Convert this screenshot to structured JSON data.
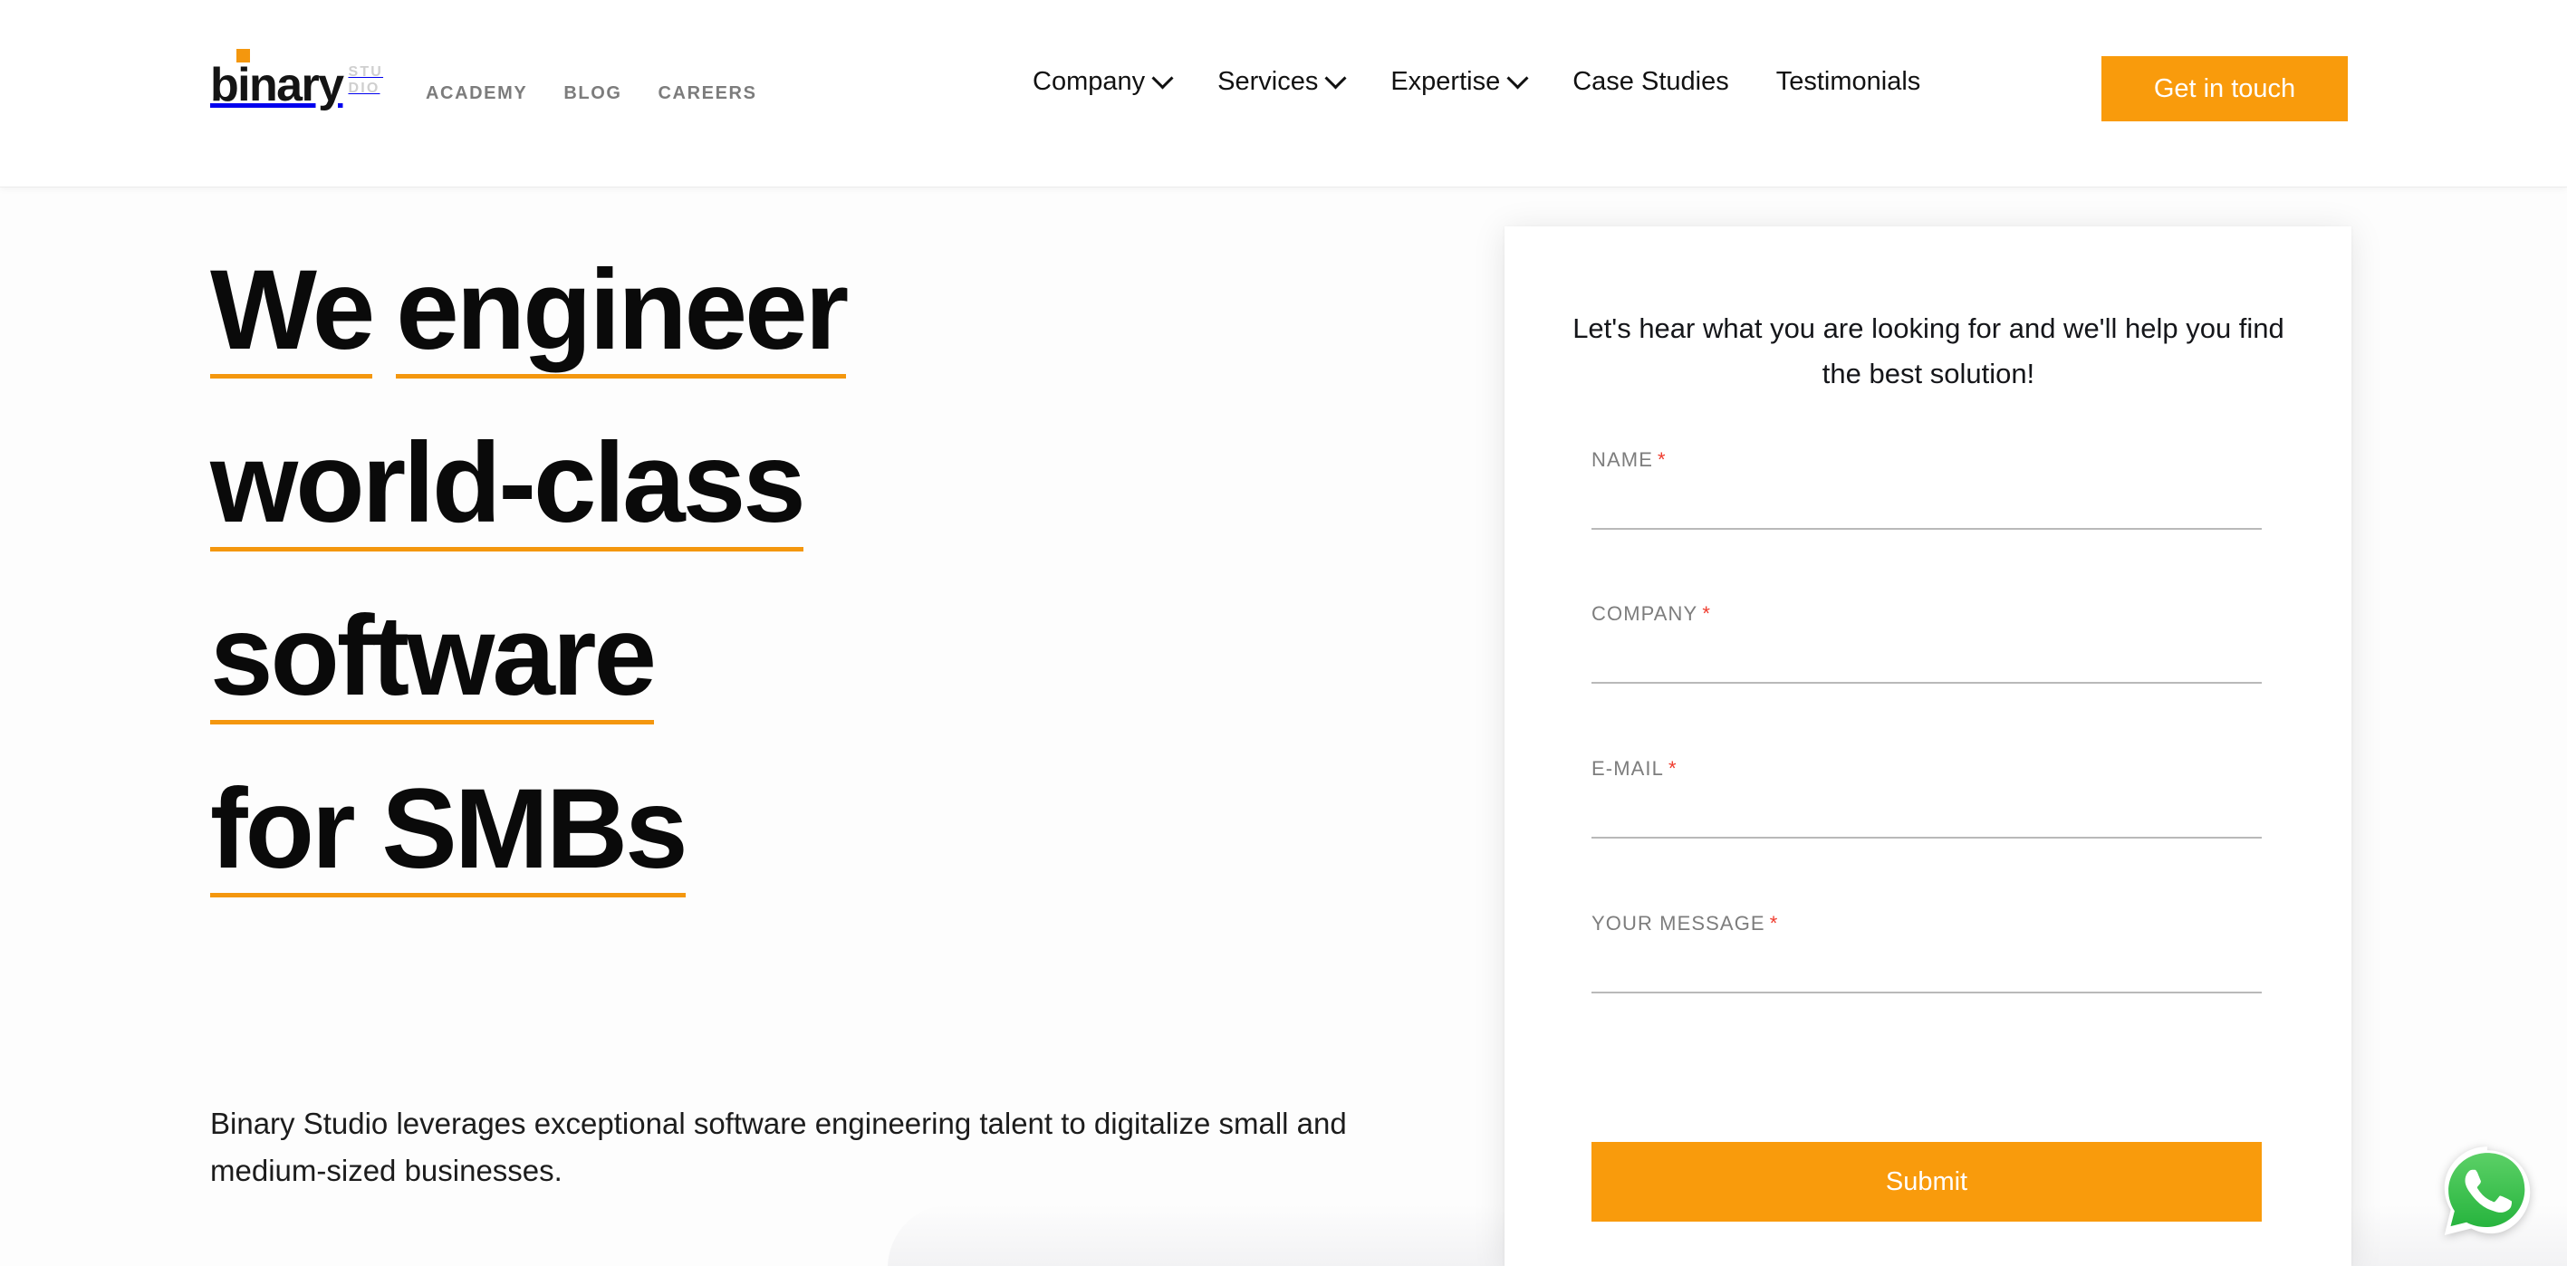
{
  "brand": {
    "logo_word": "binary",
    "logo_sub_line1": "STU",
    "logo_sub_line2": "DIO",
    "accent_color": "#F99B0C",
    "underline_color": "#F4970E"
  },
  "header": {
    "mini_nav": [
      {
        "label": "ACADEMY"
      },
      {
        "label": "BLOG"
      },
      {
        "label": "CAREERS"
      }
    ],
    "main_nav": [
      {
        "label": "Company",
        "has_dropdown": true
      },
      {
        "label": "Services",
        "has_dropdown": true
      },
      {
        "label": "Expertise",
        "has_dropdown": true
      },
      {
        "label": "Case Studies",
        "has_dropdown": false
      },
      {
        "label": "Testimonials",
        "has_dropdown": false
      }
    ],
    "cta_label": "Get in touch"
  },
  "hero": {
    "line1_word1": "We",
    "line1_word2": "engineer",
    "line2": "world-class",
    "line3": "software",
    "line4": "for SMBs",
    "subtitle": "Binary Studio leverages exceptional software engineering talent to digitalize small and medium-sized businesses."
  },
  "form": {
    "intro": "Let's hear what you are looking for and we'll help you find the best solution!",
    "required_mark": "*",
    "fields": [
      {
        "label": "NAME",
        "value": "",
        "placeholder": "",
        "required": true
      },
      {
        "label": "COMPANY",
        "value": "",
        "placeholder": "",
        "required": true
      },
      {
        "label": "E-MAIL",
        "value": "",
        "placeholder": "",
        "required": true
      },
      {
        "label": "YOUR MESSAGE",
        "value": "",
        "placeholder": "",
        "required": true
      }
    ],
    "submit_label": "Submit"
  },
  "floating": {
    "whatsapp_icon": "whatsapp-icon",
    "whatsapp_color": "#4AC85A"
  }
}
